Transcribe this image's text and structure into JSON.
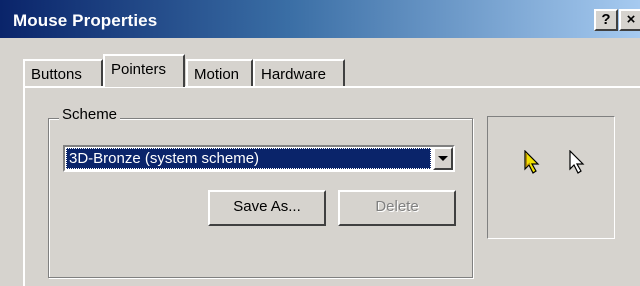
{
  "window": {
    "title": "Mouse Properties",
    "help_button": "?",
    "close_button": "×"
  },
  "tabs": [
    {
      "label": "Buttons",
      "active": false
    },
    {
      "label": "Pointers",
      "active": true
    },
    {
      "label": "Motion",
      "active": false
    },
    {
      "label": "Hardware",
      "active": false
    }
  ],
  "scheme": {
    "group_label": "Scheme",
    "selected": "3D-Bronze (system scheme)",
    "save_as_label": "Save As...",
    "delete_label": "Delete",
    "delete_enabled": false
  },
  "preview": {
    "icons": [
      "bronze-arrow-cursor-icon",
      "white-arrow-cursor-icon"
    ]
  },
  "colors": {
    "titlebar_start": "#0a246a",
    "titlebar_end": "#a6caf0",
    "selection": "#0a246a",
    "face": "#d6d3ce",
    "bronze_cursor": "#f0e000"
  }
}
